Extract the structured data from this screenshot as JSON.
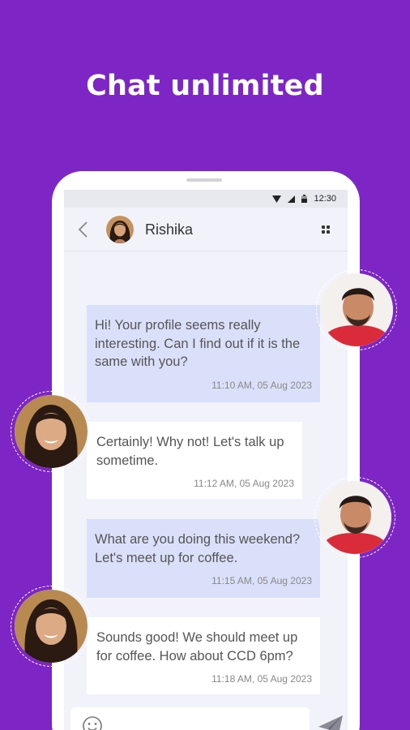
{
  "headline": "Chat unlimited",
  "status_bar": {
    "time": "12:30",
    "icons": [
      "signal-icon",
      "wifi-icon",
      "battery-icon"
    ]
  },
  "chat_header": {
    "contact_name": "Rishika",
    "back_icon": "chevron-left-icon",
    "menu_icon": "grid-menu-icon"
  },
  "messages": [
    {
      "from": "sent",
      "text": "Hi! Your profile seems really interesting. Can I find out if it is the same with you?",
      "time": "11:10 AM, 05 Aug 2023"
    },
    {
      "from": "received",
      "text": "Certainly! Why not! Let's talk up sometime.",
      "time": "11:12 AM, 05 Aug 2023"
    },
    {
      "from": "sent",
      "text": "What are you doing this weekend? Let's meet up for coffee.",
      "time": "11:15 AM, 05 Aug 2023"
    },
    {
      "from": "received",
      "text": "Sounds good! We should meet up for coffee. How about CCD 6pm?",
      "time": "11:18 AM, 05 Aug 2023"
    }
  ],
  "composer": {
    "placeholder": "",
    "emoji_icon": "smiley-icon",
    "send_icon": "send-icon"
  },
  "colors": {
    "background": "#7e25c6",
    "sent_bubble": "#dbe0fa",
    "received_bubble": "#ffffff",
    "chat_background": "#f2f3fa"
  }
}
